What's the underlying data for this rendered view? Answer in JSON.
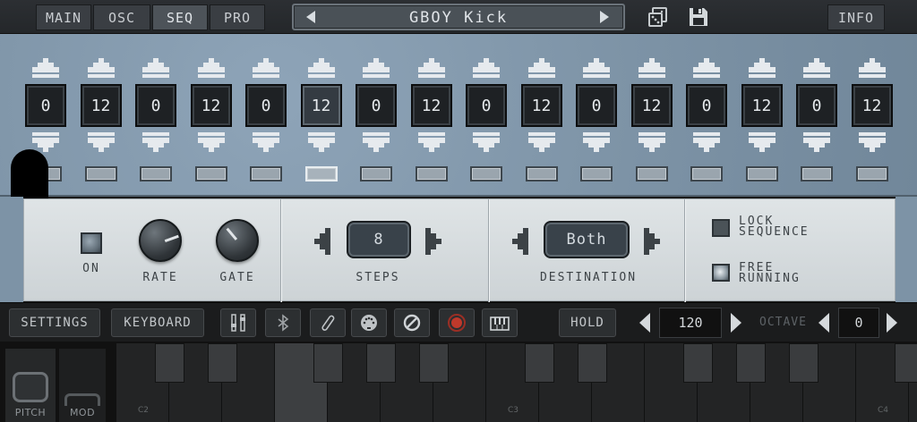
{
  "nav": {
    "tabs": [
      {
        "label": "MAIN",
        "active": false
      },
      {
        "label": "OSC",
        "active": false
      },
      {
        "label": "SEQ",
        "active": true
      },
      {
        "label": "PRO",
        "active": false
      }
    ],
    "preset_name": "GBOY Kick",
    "dice_icon": "dice-icon",
    "save_icon": "floppy-disk-icon",
    "info_label": "INFO"
  },
  "sequencer": {
    "steps": [
      {
        "value": "0"
      },
      {
        "value": "12"
      },
      {
        "value": "0"
      },
      {
        "value": "12"
      },
      {
        "value": "0"
      },
      {
        "value": "12"
      },
      {
        "value": "0"
      },
      {
        "value": "12"
      },
      {
        "value": "0"
      },
      {
        "value": "12"
      },
      {
        "value": "0"
      },
      {
        "value": "12"
      },
      {
        "value": "0"
      },
      {
        "value": "12"
      },
      {
        "value": "0"
      },
      {
        "value": "12"
      }
    ],
    "active_step": 6
  },
  "controls": {
    "on_label": "ON",
    "rate_label": "RATE",
    "gate_label": "GATE",
    "steps_value": "8",
    "steps_label": "STEPS",
    "destination_value": "Both",
    "destination_label": "DESTINATION",
    "lock_label_1": "LOCK",
    "lock_label_2": "SEQUENCE",
    "lock_checked": false,
    "free_label_1": "FREE",
    "free_label_2": "RUNNING",
    "free_checked": true
  },
  "toolbar": {
    "settings_label": "SETTINGS",
    "keyboard_label": "KEYBOARD",
    "icons": [
      "mixer-icon",
      "bluetooth-icon",
      "link-icon",
      "midi-icon",
      "stop-icon",
      "record-icon",
      "piano-icon"
    ],
    "hold_label": "HOLD",
    "bpm": "120",
    "octave_label": "OCTAVE",
    "octave": "0"
  },
  "keyboard": {
    "pitch_label": "PITCH",
    "mod_label": "MOD",
    "key_labels": {
      "c2": "C2",
      "c3": "C3",
      "c4": "C4"
    }
  },
  "colors": {
    "panel_blue": "#7d93a6",
    "panel_gray": "#d7dcde",
    "record_red": "#c0392b"
  }
}
